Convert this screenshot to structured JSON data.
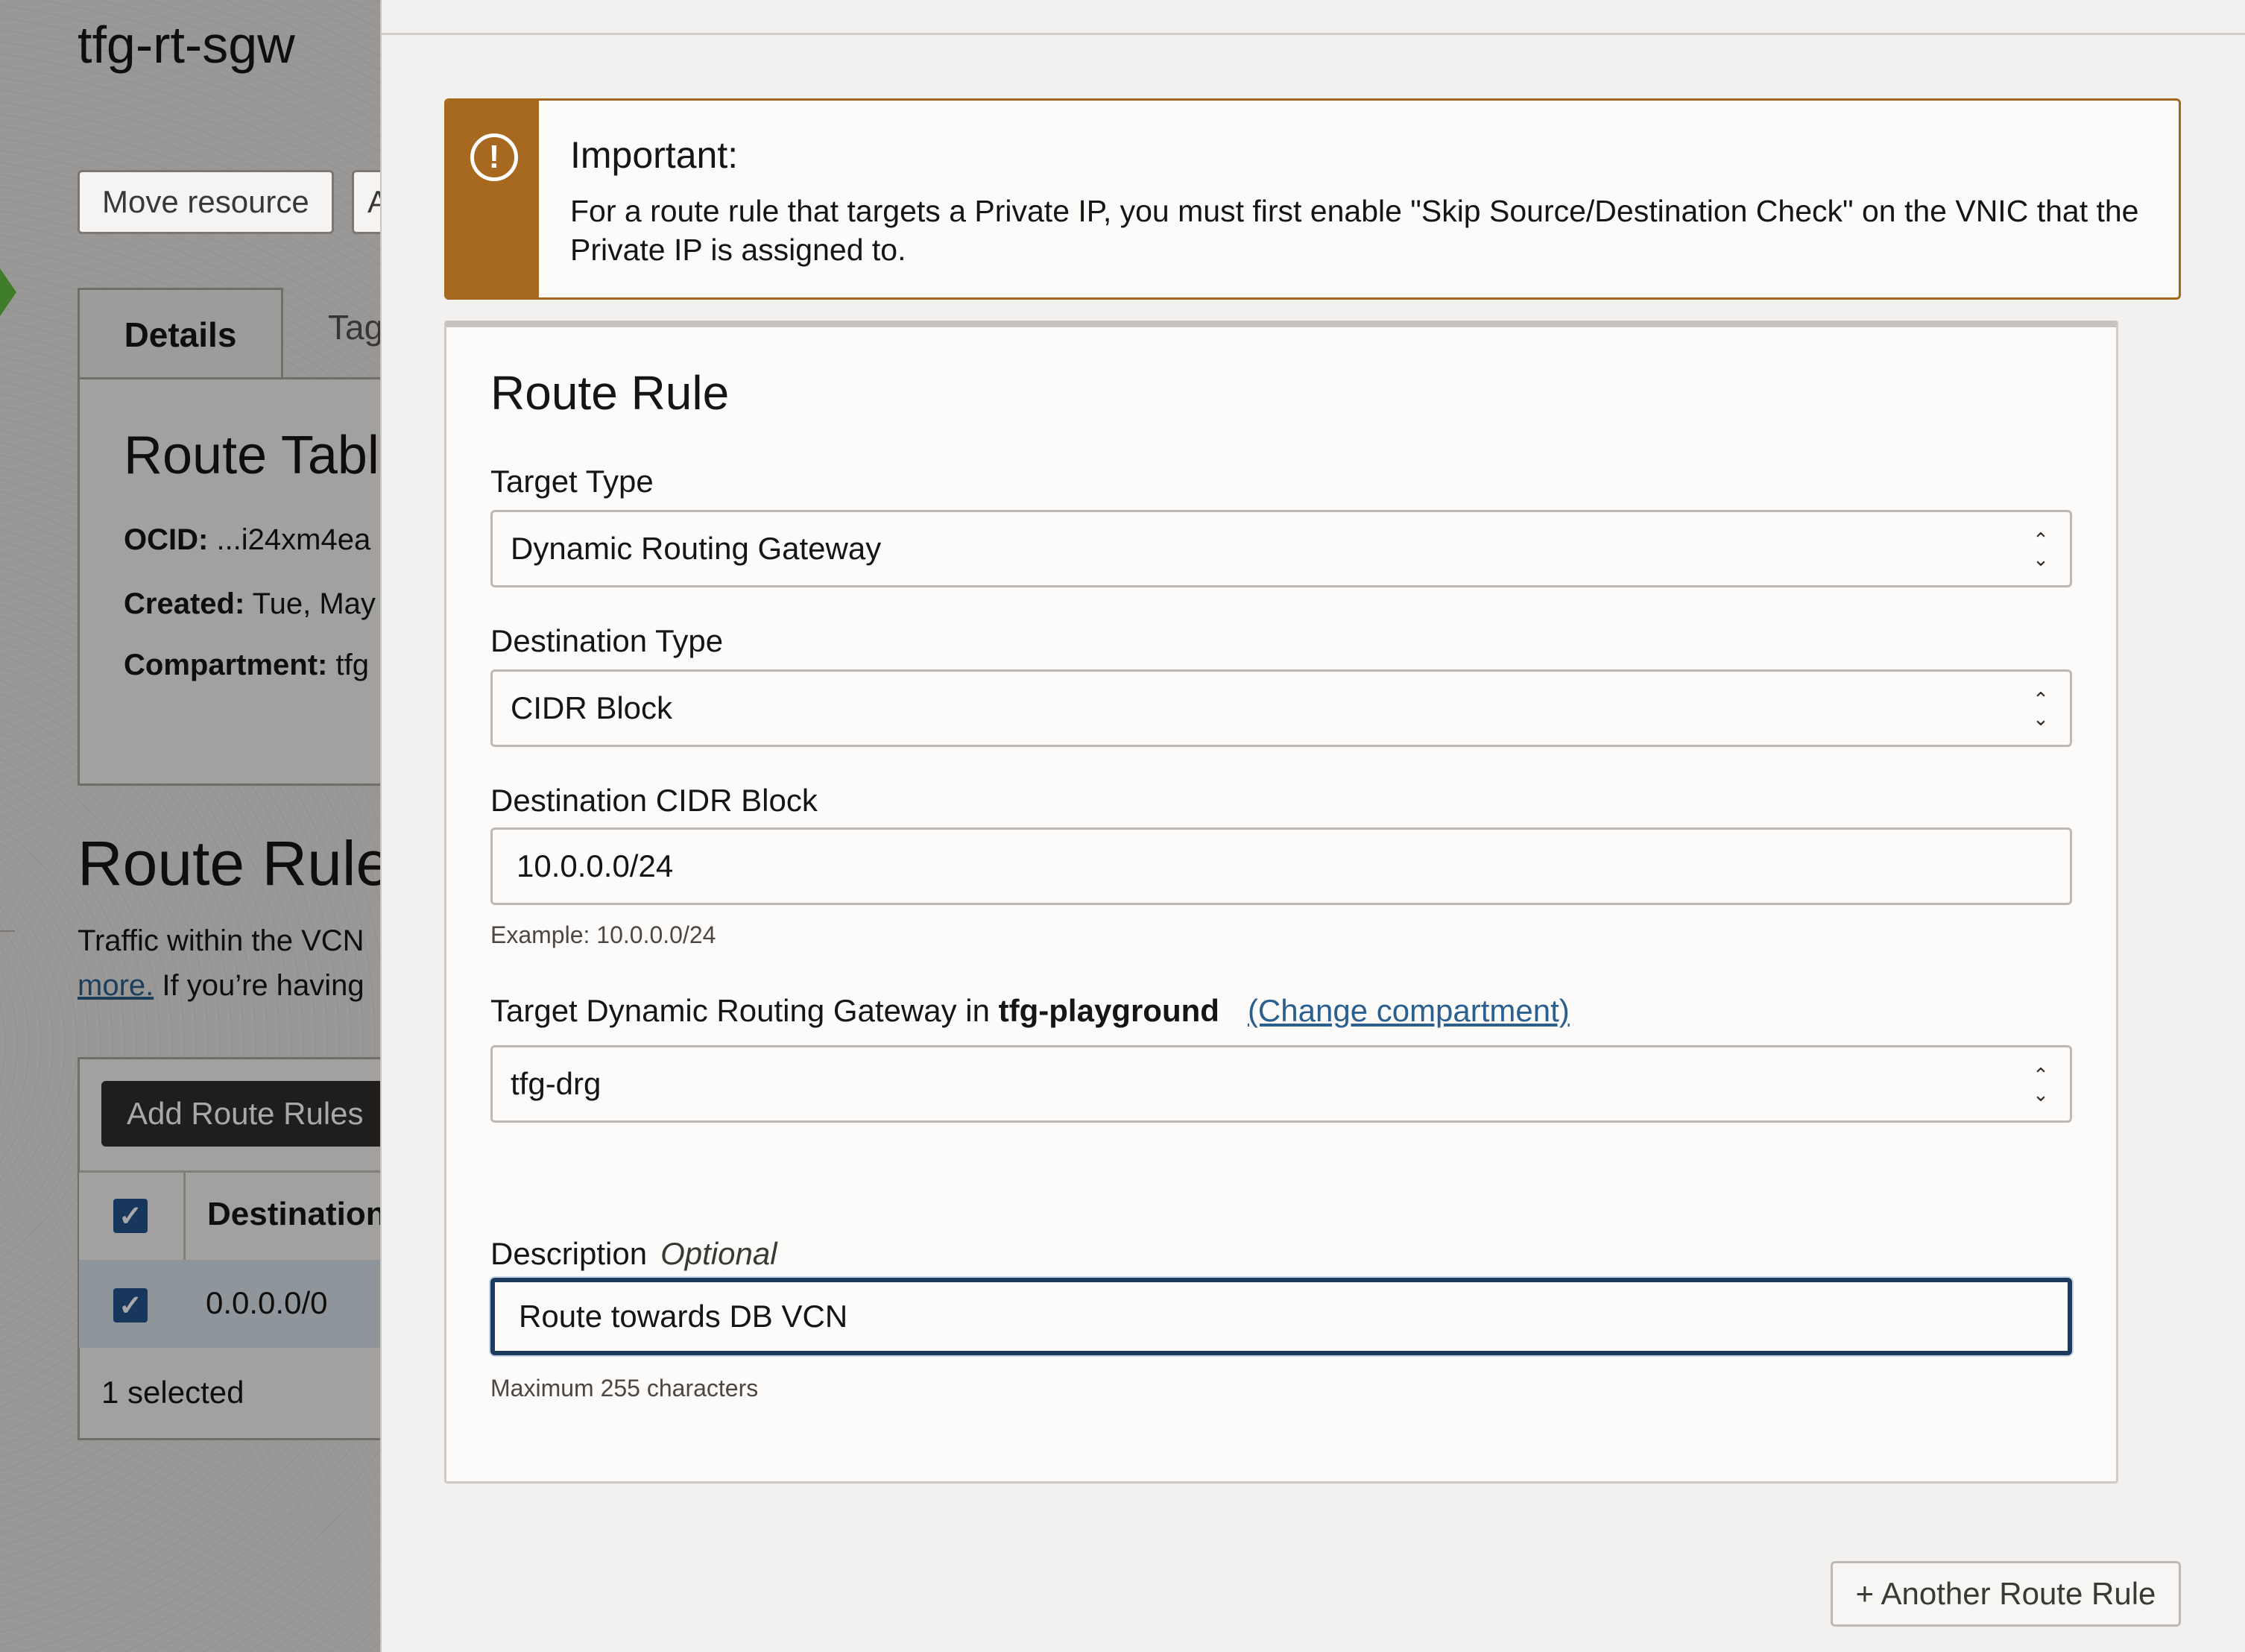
{
  "background": {
    "page_title": "tfg-rt-sgw",
    "move_resource_label": "Move resource",
    "second_button_label": "A",
    "tabs": [
      {
        "label": "Details"
      },
      {
        "label": "Tag"
      }
    ],
    "details": {
      "heading": "Route Tabl",
      "ocid_label": "OCID:",
      "ocid_value": "...i24xm4ea",
      "created_label": "Created:",
      "created_value": "Tue, May",
      "compartment_label": "Compartment:",
      "compartment_value": "tfg"
    },
    "section_title": "Route Rule",
    "paragraph_line1": "Traffic within the VCN",
    "paragraph_link": "more.",
    "paragraph_line2_rest": " If you’re having",
    "add_rules_label": "Add Route Rules",
    "table": {
      "header_destination": "Destination",
      "rows": [
        {
          "destination": "0.0.0.0/0"
        }
      ],
      "selected_text": "1 selected"
    }
  },
  "alert": {
    "title": "Important:",
    "body": "For a route rule that targets a Private IP, you must first enable \"Skip Source/Destination Check\" on the VNIC that the Private IP is assigned to."
  },
  "route_rule": {
    "title": "Route Rule",
    "target_type": {
      "label": "Target Type",
      "value": "Dynamic Routing Gateway"
    },
    "destination_type": {
      "label": "Destination Type",
      "value": "CIDR Block"
    },
    "destination_cidr": {
      "label": "Destination CIDR Block",
      "value": "10.0.0.0/24",
      "hint": "Example: 10.0.0.0/24"
    },
    "target_drg": {
      "label_prefix": "Target Dynamic Routing Gateway in",
      "compartment": "tfg-playground",
      "change_link": "(Change compartment)",
      "value": "tfg-drg"
    },
    "description": {
      "label": "Description",
      "optional": "Optional",
      "value": "Route towards DB VCN",
      "hint": "Maximum 255 characters"
    }
  },
  "another_rule_label": "+ Another Route Rule",
  "colors": {
    "alert_accent": "#a76820",
    "link": "#2a5f8f",
    "checkbox": "#24548c",
    "focus_border": "#1c3a5b"
  }
}
